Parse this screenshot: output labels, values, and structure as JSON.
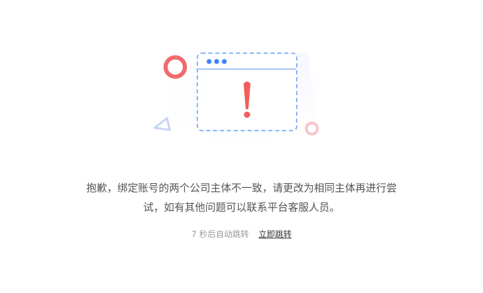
{
  "message": {
    "line1": "抱歉，绑定账号的两个公司主体不一致，请更改为相同主体再进行尝",
    "line2": "试，如有其他问题可以联系平台客服人员。"
  },
  "redirect": {
    "countdown_text": "7 秒后自动跳转",
    "jump_now_label": "立即跳转"
  },
  "illustration": {
    "icon": "browser-warning-icon",
    "accent_color": "#f25c5c",
    "frame_color": "#8ab4f8",
    "dot_color": "#3b82f6"
  }
}
